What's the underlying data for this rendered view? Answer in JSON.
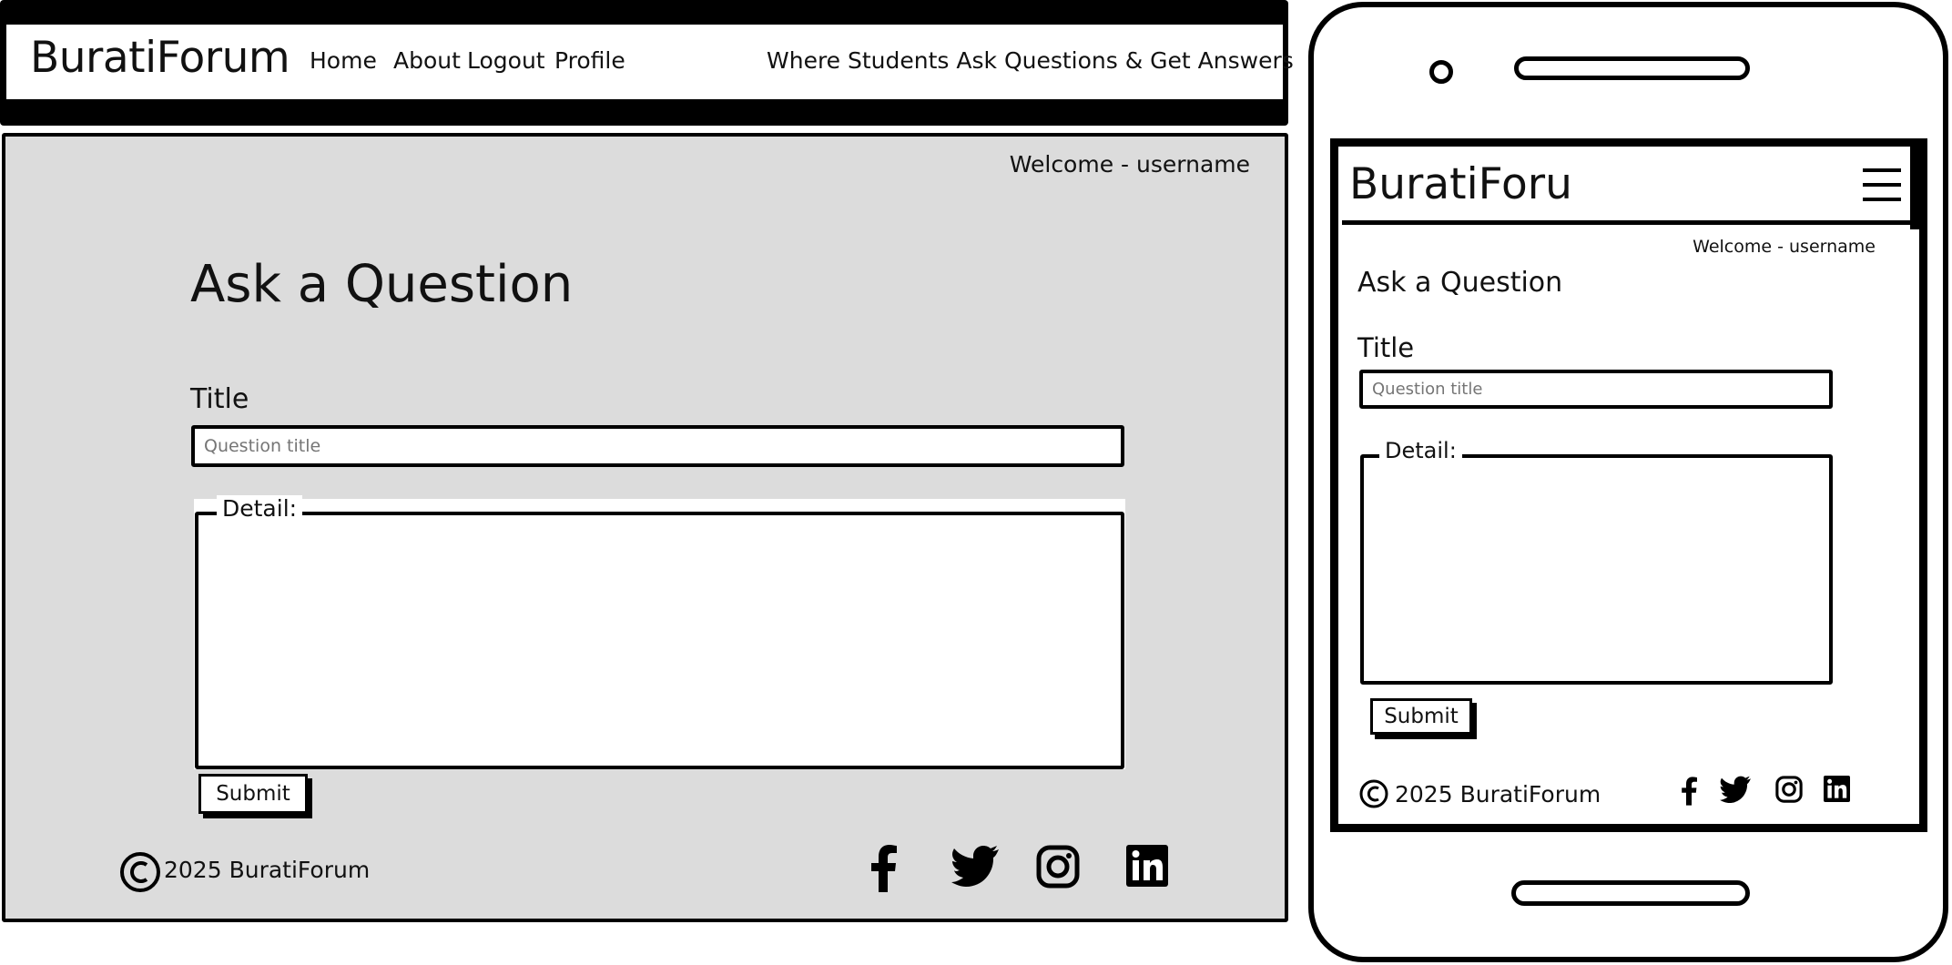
{
  "desktop": {
    "brand": "BuratiForum",
    "nav": [
      "Home",
      "About",
      "Logout",
      "Profile"
    ],
    "tagline": "Where Students Ask Questions & Get Answers",
    "welcome": "Welcome - username",
    "heading": "Ask a Question",
    "title_label": "Title",
    "title_placeholder": "Question title",
    "detail_label": "Detail:",
    "submit_label": "Submit",
    "copyright": "2025 BuratiForum",
    "social_icons": [
      "facebook-icon",
      "twitter-icon",
      "instagram-icon",
      "linkedin-icon"
    ]
  },
  "mobile": {
    "brand": "BuratiForu",
    "welcome": "Welcome - username",
    "heading": "Ask a Question",
    "title_label": "Title",
    "title_placeholder": "Question title",
    "detail_label": "Detail:",
    "submit_label": "Submit",
    "copyright": "2025 BuratiForum",
    "social_icons": [
      "facebook-icon",
      "twitter-icon",
      "instagram-icon",
      "linkedin-icon"
    ]
  }
}
